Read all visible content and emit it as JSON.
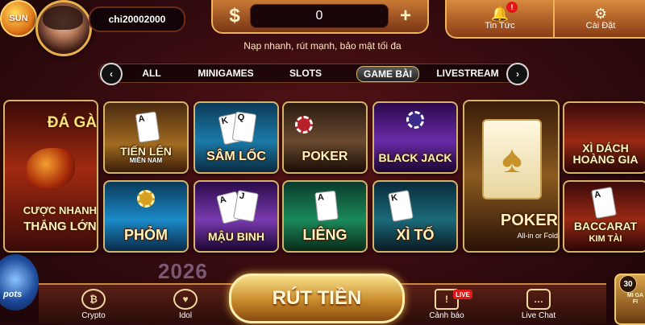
{
  "header": {
    "logo_text": "SUN",
    "username": "chi20002000",
    "balance": {
      "currency_symbol": "$",
      "value": "0",
      "add_symbol": "+"
    },
    "news": {
      "label": "Tin Tức",
      "badge": "!"
    },
    "settings": {
      "label": "Cài Đặt"
    },
    "slogan": "Nạp nhanh, rút mạnh, bảo mật tối đa"
  },
  "tabs": {
    "items": [
      "ALL",
      "MINIGAMES",
      "SLOTS",
      "GAME BÀI",
      "LIVESTREAM"
    ],
    "active": "GAME BÀI",
    "prev_symbol": "‹",
    "next_symbol": "›"
  },
  "featured": {
    "left": {
      "title": "ĐÁ GÀ",
      "subtitle_1": "CƯỢC NHANH",
      "subtitle_2": "THẮNG LỚN"
    },
    "poker_big": {
      "title": "POKER",
      "subtitle": "All-in or Fold"
    }
  },
  "games": [
    {
      "title": "TIẾN LÊN",
      "subtitle": "MIỀN NAM"
    },
    {
      "title": "SÂM LỐC",
      "subtitle": ""
    },
    {
      "title": "POKER",
      "subtitle": ""
    },
    {
      "title": "BLACK JACK",
      "subtitle": ""
    },
    {
      "title": "PHỎM",
      "subtitle": ""
    },
    {
      "title": "MẬU BINH",
      "subtitle": ""
    },
    {
      "title": "LIÊNG",
      "subtitle": ""
    },
    {
      "title": "XÌ TỐ",
      "subtitle": ""
    }
  ],
  "right_games": [
    {
      "title": "XÌ DÁCH",
      "subtitle": "HOÀNG GIA"
    },
    {
      "title": "BACCARAT",
      "subtitle": "KIM TÀI"
    }
  ],
  "bottom_nav": {
    "crypto": "Crypto",
    "idol": "Idol",
    "withdraw": "RÚT TIỀN",
    "canh_bao": "Cảnh báo",
    "live_badge": "LIVE",
    "live_chat": "Live Chat"
  },
  "decor": {
    "year": "2026",
    "side_count": "30",
    "side_label": "MI GA FI",
    "side_left_label": "pots"
  },
  "colors": {
    "accent_gold": "#d6b26a",
    "alert_red": "#e01818",
    "background": "#3a0c10"
  }
}
